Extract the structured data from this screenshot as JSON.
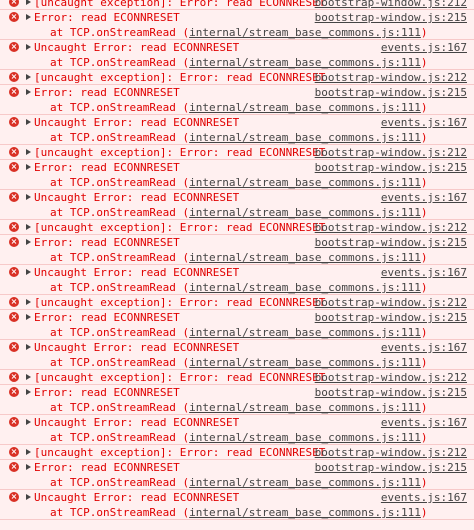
{
  "icons": {
    "error": "error-icon",
    "expand": "expand-triangle-icon"
  },
  "colors": {
    "error_text": "#e00000",
    "error_bg": "#fff0f0",
    "error_border": "#f7c9c9",
    "icon": "#d93025",
    "link": "#444444"
  },
  "rows": [
    {
      "type": "uncaught",
      "text": "[uncaught exception]: Error: read ECONNRESET",
      "source": "bootstrap-window.js:212"
    },
    {
      "type": "error",
      "text": "Error: read ECONNRESET",
      "stack": "at TCP.onStreamRead",
      "stack_link": "internal/stream_base_commons.js:111",
      "source": "bootstrap-window.js:215"
    },
    {
      "type": "uncaught-error",
      "text": "Uncaught Error: read ECONNRESET",
      "stack": "at TCP.onStreamRead",
      "stack_link": "internal/stream_base_commons.js:111",
      "source": "events.js:167"
    },
    {
      "type": "uncaught",
      "text": "[uncaught exception]: Error: read ECONNRESET",
      "source": "bootstrap-window.js:212"
    },
    {
      "type": "error",
      "text": "Error: read ECONNRESET",
      "stack": "at TCP.onStreamRead",
      "stack_link": "internal/stream_base_commons.js:111",
      "source": "bootstrap-window.js:215"
    },
    {
      "type": "uncaught-error",
      "text": "Uncaught Error: read ECONNRESET",
      "stack": "at TCP.onStreamRead",
      "stack_link": "internal/stream_base_commons.js:111",
      "source": "events.js:167"
    },
    {
      "type": "uncaught",
      "text": "[uncaught exception]: Error: read ECONNRESET",
      "source": "bootstrap-window.js:212"
    },
    {
      "type": "error",
      "text": "Error: read ECONNRESET",
      "stack": "at TCP.onStreamRead",
      "stack_link": "internal/stream_base_commons.js:111",
      "source": "bootstrap-window.js:215"
    },
    {
      "type": "uncaught-error",
      "text": "Uncaught Error: read ECONNRESET",
      "stack": "at TCP.onStreamRead",
      "stack_link": "internal/stream_base_commons.js:111",
      "source": "events.js:167"
    },
    {
      "type": "uncaught",
      "text": "[uncaught exception]: Error: read ECONNRESET",
      "source": "bootstrap-window.js:212"
    },
    {
      "type": "error",
      "text": "Error: read ECONNRESET",
      "stack": "at TCP.onStreamRead",
      "stack_link": "internal/stream_base_commons.js:111",
      "source": "bootstrap-window.js:215"
    },
    {
      "type": "uncaught-error",
      "text": "Uncaught Error: read ECONNRESET",
      "stack": "at TCP.onStreamRead",
      "stack_link": "internal/stream_base_commons.js:111",
      "source": "events.js:167"
    },
    {
      "type": "uncaught",
      "text": "[uncaught exception]: Error: read ECONNRESET",
      "source": "bootstrap-window.js:212"
    },
    {
      "type": "error",
      "text": "Error: read ECONNRESET",
      "stack": "at TCP.onStreamRead",
      "stack_link": "internal/stream_base_commons.js:111",
      "source": "bootstrap-window.js:215"
    },
    {
      "type": "uncaught-error",
      "text": "Uncaught Error: read ECONNRESET",
      "stack": "at TCP.onStreamRead",
      "stack_link": "internal/stream_base_commons.js:111",
      "source": "events.js:167"
    },
    {
      "type": "uncaught",
      "text": "[uncaught exception]: Error: read ECONNRESET",
      "source": "bootstrap-window.js:212"
    },
    {
      "type": "error",
      "text": "Error: read ECONNRESET",
      "stack": "at TCP.onStreamRead",
      "stack_link": "internal/stream_base_commons.js:111",
      "source": "bootstrap-window.js:215"
    },
    {
      "type": "uncaught-error",
      "text": "Uncaught Error: read ECONNRESET",
      "stack": "at TCP.onStreamRead",
      "stack_link": "internal/stream_base_commons.js:111",
      "source": "events.js:167"
    },
    {
      "type": "uncaught",
      "text": "[uncaught exception]: Error: read ECONNRESET",
      "source": "bootstrap-window.js:212"
    },
    {
      "type": "error",
      "text": "Error: read ECONNRESET",
      "stack": "at TCP.onStreamRead",
      "stack_link": "internal/stream_base_commons.js:111",
      "source": "bootstrap-window.js:215"
    },
    {
      "type": "uncaught-error",
      "text": "Uncaught Error: read ECONNRESET",
      "stack": "at TCP.onStreamRead",
      "stack_link": "internal/stream_base_commons.js:111",
      "source": "events.js:167"
    }
  ]
}
